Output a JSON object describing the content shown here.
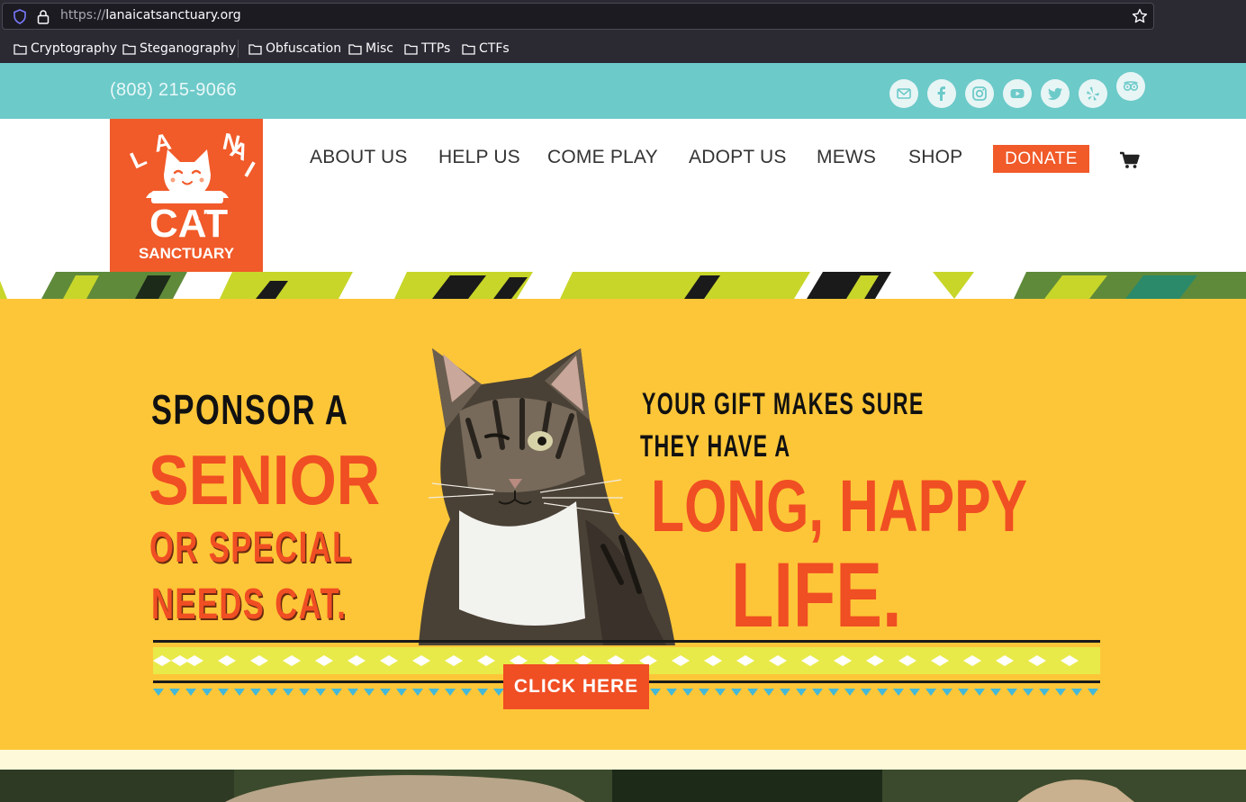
{
  "browser": {
    "url_scheme": "https://",
    "url_host": "lanaicatsanctuary.org",
    "bookmarks": [
      {
        "label": "Cryptography"
      },
      {
        "label": "Steganography"
      },
      {
        "label": "Obfuscation"
      },
      {
        "label": "Misc"
      },
      {
        "label": "TTPs"
      },
      {
        "label": "CTFs"
      }
    ]
  },
  "topbar": {
    "phone": "(808) 215-9066",
    "social_icons": [
      "mail-icon",
      "facebook-icon",
      "instagram-icon",
      "youtube-icon",
      "twitter-icon",
      "yelp-icon",
      "tripadvisor-icon"
    ]
  },
  "logo": {
    "line1": "LANAI",
    "line2": "CAT",
    "line3": "SANCTUARY"
  },
  "nav": {
    "items": [
      {
        "label": "ABOUT US"
      },
      {
        "label": "HELP US"
      },
      {
        "label": "COME PLAY"
      },
      {
        "label": "ADOPT US"
      },
      {
        "label": "MEWS"
      },
      {
        "label": "SHOP"
      }
    ],
    "donate_label": "DONATE",
    "cart_icon": "cart-icon"
  },
  "hero": {
    "left_line1": "SPONSOR A",
    "left_line2": "SENIOR",
    "left_line3": "OR SPECIAL",
    "left_line4": "NEEDS CAT.",
    "right_line1": "YOUR GIFT MAKES SURE",
    "right_line2": "THEY HAVE A",
    "right_line3": "LONG, HAPPY",
    "right_line4": "LIFE.",
    "button_label": "CLICK HERE",
    "colors": {
      "background": "#fdc638",
      "accent": "#f04e23"
    }
  },
  "colors": {
    "topbar": "#6ccac9",
    "logo_bg": "#f15a29",
    "donate": "#f15a29"
  }
}
